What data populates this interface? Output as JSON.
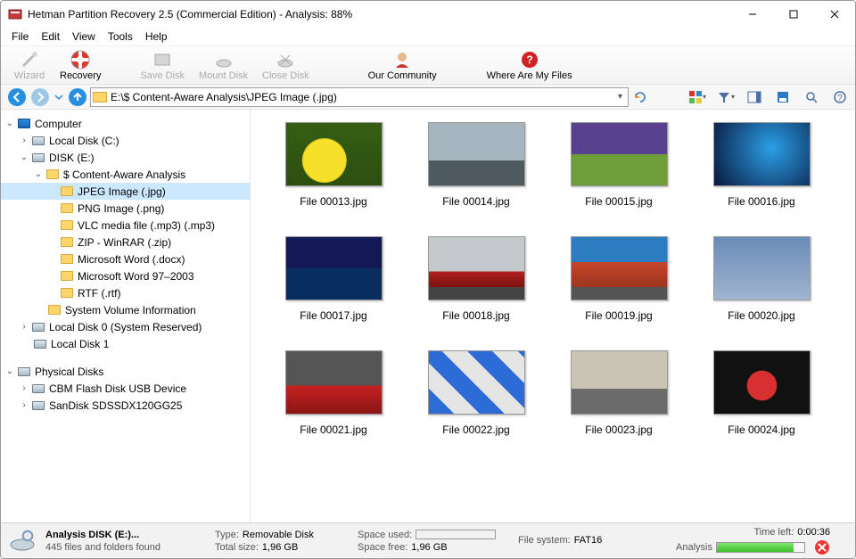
{
  "title": "Hetman Partition Recovery 2.5 (Commercial Edition) - Analysis: 88%",
  "menu": {
    "file": "File",
    "edit": "Edit",
    "view": "View",
    "tools": "Tools",
    "help": "Help"
  },
  "toolbar": {
    "wizard": "Wizard",
    "recovery": "Recovery",
    "savedisk": "Save Disk",
    "mountdisk": "Mount Disk",
    "closedisk": "Close Disk",
    "community": "Our Community",
    "wherefiles": "Where Are My Files"
  },
  "address": "E:\\$ Content-Aware Analysis\\JPEG Image (.jpg)",
  "tree": {
    "computer": "Computer",
    "localC": "Local Disk (C:)",
    "diskE": "DISK (E:)",
    "caa": "$ Content-Aware Analysis",
    "jpeg": "JPEG Image (.jpg)",
    "png": "PNG Image (.png)",
    "mp3": "VLC media file (.mp3) (.mp3)",
    "zip": "ZIP - WinRAR (.zip)",
    "docx": "Microsoft Word (.docx)",
    "doc": "Microsoft Word 97–2003",
    "rtf": "RTF (.rtf)",
    "svi": "System Volume Information",
    "localDisk0": "Local Disk 0 (System Reserved)",
    "localDisk1": "Local Disk 1",
    "physical": "Physical Disks",
    "cbm": "CBM Flash Disk USB Device",
    "sandisk": "SanDisk SDSSDX120GG25"
  },
  "files": [
    {
      "name": "File 00013.jpg",
      "cls": "img-tulips"
    },
    {
      "name": "File 00014.jpg",
      "cls": "img-suv"
    },
    {
      "name": "File 00015.jpg",
      "cls": "img-forest"
    },
    {
      "name": "File 00016.jpg",
      "cls": "img-neon"
    },
    {
      "name": "File 00017.jpg",
      "cls": "img-bridge"
    },
    {
      "name": "File 00018.jpg",
      "cls": "img-redcar"
    },
    {
      "name": "File 00019.jpg",
      "cls": "img-diner"
    },
    {
      "name": "File 00020.jpg",
      "cls": "img-clouds"
    },
    {
      "name": "File 00021.jpg",
      "cls": "img-red2"
    },
    {
      "name": "File 00022.jpg",
      "cls": "img-blue4"
    },
    {
      "name": "File 00023.jpg",
      "cls": "img-road"
    },
    {
      "name": "File 00024.jpg",
      "cls": "img-gauge"
    }
  ],
  "status": {
    "l1": "Analysis DISK (E:)...",
    "l2": "445 files and folders found",
    "typeL": "Type:",
    "typeV": "Removable Disk",
    "totalL": "Total size:",
    "totalV": "1,96 GB",
    "usedL": "Space used:",
    "freeL": "Space free:",
    "freeV": "1,96 GB",
    "fsL": "File system:",
    "fsV": "FAT16",
    "timeL": "Time left:",
    "timeV": "0:00:36",
    "analysisL": "Analysis"
  }
}
